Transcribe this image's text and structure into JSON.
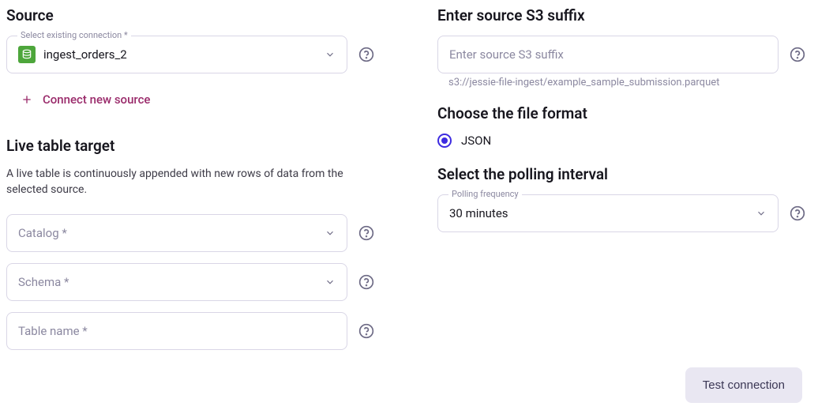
{
  "source": {
    "title": "Source",
    "select_label": "Select existing connection *",
    "selected_value": "ingest_orders_2",
    "connect_new_label": "Connect new source"
  },
  "live_target": {
    "title": "Live table target",
    "description": "A live table is continuously appended with new rows of data from the selected source.",
    "catalog_placeholder": "Catalog *",
    "schema_placeholder": "Schema *",
    "table_placeholder": "Table name *"
  },
  "s3_suffix": {
    "title": "Enter source S3 suffix",
    "placeholder": "Enter source S3 suffix",
    "hint": "s3://jessie-file-ingest/example_sample_submission.parquet"
  },
  "file_format": {
    "title": "Choose the file format",
    "option_json": "JSON"
  },
  "polling": {
    "title": "Select the polling interval",
    "frequency_label": "Polling frequency",
    "selected_value": "30 minutes"
  },
  "footer": {
    "test_connection": "Test connection"
  }
}
